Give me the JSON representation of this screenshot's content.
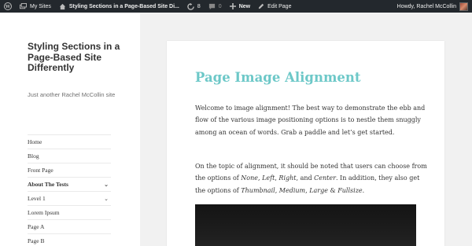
{
  "adminbar": {
    "my_sites": "My Sites",
    "site_name": "Styling Sections in a Page-Based Site Di...",
    "updates_count": "8",
    "comments_count": "0",
    "new_label": "New",
    "edit_label": "Edit Page",
    "howdy": "Howdy, Rachel McCollin"
  },
  "site": {
    "title": "Styling Sections in a Page-Based Site Differently",
    "description": "Just another Rachel McCollin site"
  },
  "menu": {
    "items": [
      {
        "label": "Home"
      },
      {
        "label": "Blog"
      },
      {
        "label": "Front Page"
      },
      {
        "label": "About The Tests"
      },
      {
        "label": "Level 1"
      },
      {
        "label": "Lorem Ipsum"
      },
      {
        "label": "Page A"
      },
      {
        "label": "Page B"
      }
    ]
  },
  "article": {
    "title": "Page Image Alignment",
    "p1": "Welcome to image alignment! The best way to demonstrate the ebb and flow of the various image positioning options is to nestle them snuggly among an ocean of words. Grab a paddle and let’s get started.",
    "p2": {
      "a": "On the topic of alignment, it should be noted that users can choose from the options of ",
      "none": "None",
      "sep1": ", ",
      "left": "Left",
      "sep2": ", ",
      "right": "Right",
      "sep3": ", and ",
      "center": "Center",
      "b": ". In addition, they also get the options of ",
      "thumbnail": "Thumbnail",
      "sep4": ", ",
      "medium": "Medium",
      "sep5": ", ",
      "large": "Large",
      "sep6": " & ",
      "fullsize": "Fullsize",
      "end": "."
    }
  },
  "colors": {
    "adminbar_bg": "#23282d",
    "title_accent": "#6dc8c8",
    "text": "#333333"
  }
}
